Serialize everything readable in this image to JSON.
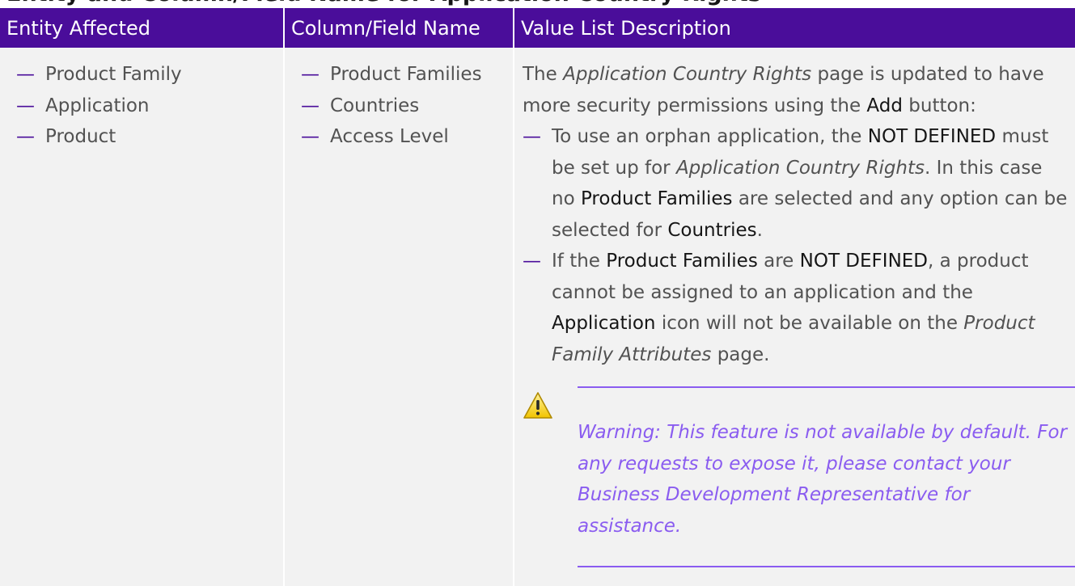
{
  "heading_cut": "Entity and Column/Field Name for Application Country Rights",
  "table": {
    "headers": [
      "Entity Affected",
      "Column/Field Name",
      "Value List Description"
    ],
    "entities": [
      "Product Family",
      "Application",
      "Product"
    ],
    "fields": [
      "Product Families",
      "Countries",
      "Access Level"
    ],
    "description": {
      "intro_1": "The ",
      "intro_2": "Application Country Rights",
      "intro_3": " page is updated to have more security permissions using the ",
      "intro_4": "Add",
      "intro_5": " button:",
      "bullet1": {
        "p1": "To use an orphan application, the ",
        "p2": "NOT DEFINED",
        "p3": " must be set up for ",
        "p4": "Application Country Rights",
        "p5": ". In this case no ",
        "p6": "Product Families",
        "p7": " are selected and any option can be selected for ",
        "p8": "Countries",
        "p9": "."
      },
      "bullet2": {
        "p1": "If the ",
        "p2": "Product Families",
        "p3": " are ",
        "p4": "NOT DEFINED",
        "p5": ", a product cannot be assigned to an application and the ",
        "p6": "Application",
        "p7": " icon will not be available on the ",
        "p8": "Product Family Attributes",
        "p9": " page."
      },
      "warning": "Warning: This feature is not available by default. For any requests to expose it, please contact your Business Development Representative for assistance."
    }
  },
  "colors": {
    "header_bg": "#4a0d9a",
    "cell_bg": "#f2f2f2",
    "accent": "#8a5cf0"
  },
  "icons": {
    "warning": "warning-triangle-icon",
    "bullet": "dash-bullet"
  }
}
